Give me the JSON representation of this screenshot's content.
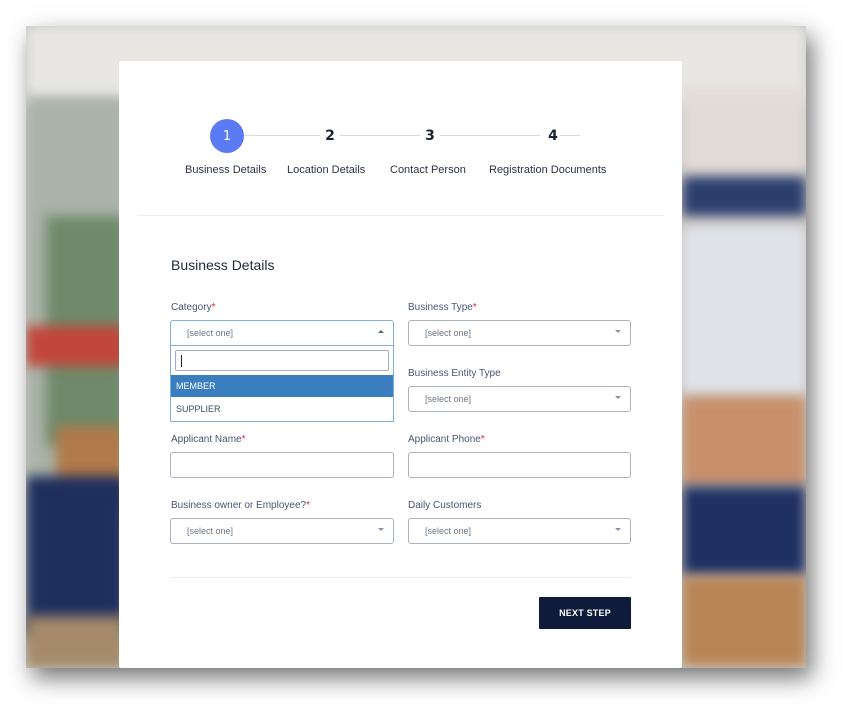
{
  "stepper": {
    "steps": [
      {
        "number": "1",
        "label": "Business Details",
        "active": true
      },
      {
        "number": "2",
        "label": "Location Details",
        "active": false
      },
      {
        "number": "3",
        "label": "Contact Person",
        "active": false
      },
      {
        "number": "4",
        "label": "Registration Documents",
        "active": false
      }
    ],
    "active_color": "#5b7bf4"
  },
  "form": {
    "section_title": "Business Details",
    "required_marker": "*",
    "fields": {
      "category": {
        "label": "Category",
        "required": true,
        "value": "[select one]",
        "open": true
      },
      "business_type": {
        "label": "Business Type",
        "required": true,
        "value": "[select one]"
      },
      "business_entity_type": {
        "label": "Business Entity Type",
        "required": false,
        "value": "[select one]"
      },
      "applicant_name": {
        "label": "Applicant Name",
        "required": true,
        "value": ""
      },
      "applicant_phone": {
        "label": "Applicant Phone",
        "required": true,
        "value": ""
      },
      "owner_or_employee": {
        "label": "Business owner or Employee?",
        "required": true,
        "value": "[select one]"
      },
      "daily_customers": {
        "label": "Daily Customers",
        "required": false,
        "value": "[select one]"
      }
    },
    "category_dropdown": {
      "search_value": "",
      "options": [
        "MEMBER",
        "SUPPLIER"
      ],
      "highlighted": "MEMBER"
    },
    "next_button_label": "NEXT STEP"
  },
  "colors": {
    "primary_button": "#0f1b3a",
    "required": "#d9262b",
    "highlight_option": "#3a7ebf"
  }
}
